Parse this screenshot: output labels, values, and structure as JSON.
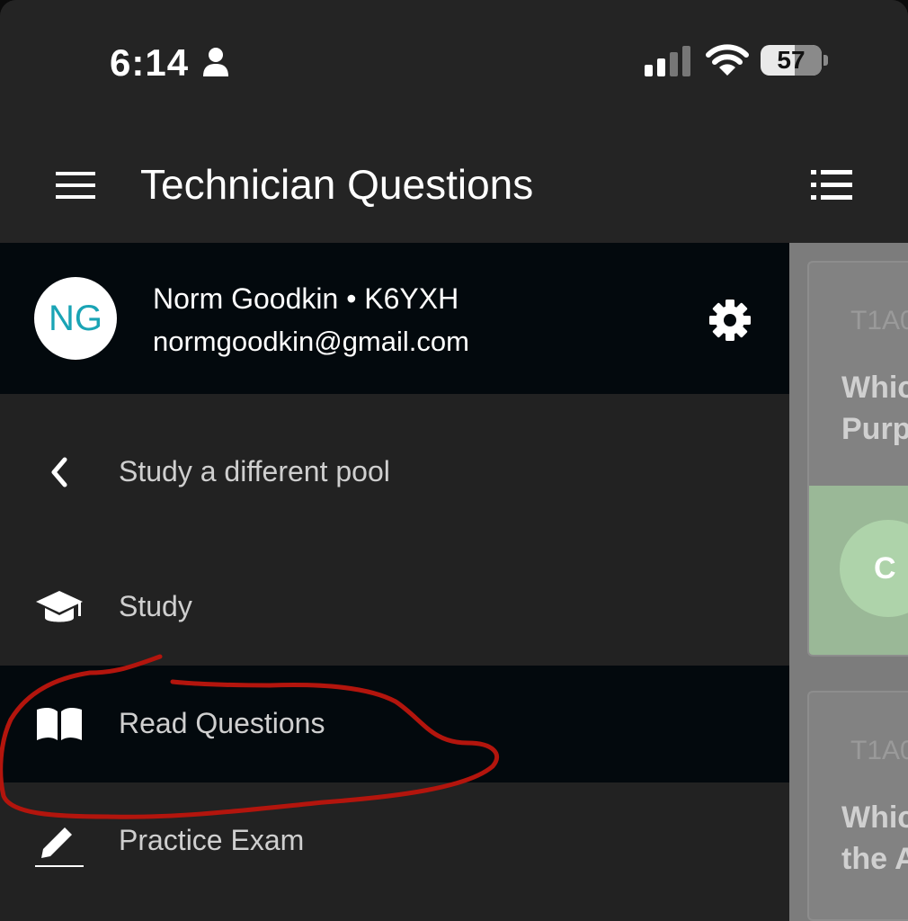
{
  "status_bar": {
    "time": "6:14",
    "battery_level": "57",
    "icons": [
      "person-icon",
      "signal-icon",
      "wifi-icon",
      "battery-icon"
    ]
  },
  "app_bar": {
    "title": "Technician Questions",
    "left_icon": "hamburger-menu-icon",
    "right_icon": "list-icon"
  },
  "drawer": {
    "user": {
      "initials": "NG",
      "name_line": "Norm Goodkin • K6YXH",
      "email": "normgoodkin@gmail.com",
      "settings_icon": "gear-icon"
    },
    "items": [
      {
        "label": "Study a different pool",
        "icon": "chevron-left-icon",
        "selected": false
      },
      {
        "label": "Study",
        "icon": "graduation-cap-icon",
        "selected": false
      },
      {
        "label": "Read Questions",
        "icon": "open-book-icon",
        "selected": true
      },
      {
        "label": "Practice Exam",
        "icon": "pencil-icon",
        "selected": false
      }
    ]
  },
  "background_content": {
    "card1_code": "T1A0",
    "card1_question_lines": [
      "Whic",
      "Purp"
    ],
    "card1_answer_letter": "C",
    "card2_code": "T1A0",
    "card2_question_lines": [
      "Whic",
      "the A"
    ]
  },
  "colors": {
    "app_bar_bg": "#242424",
    "drawer_bg": "#222222",
    "drawer_header_bg": "#03090d",
    "selected_item_bg": "#03090d",
    "avatar_text": "#1aa4b5",
    "annotation_stroke": "#b3150d"
  }
}
